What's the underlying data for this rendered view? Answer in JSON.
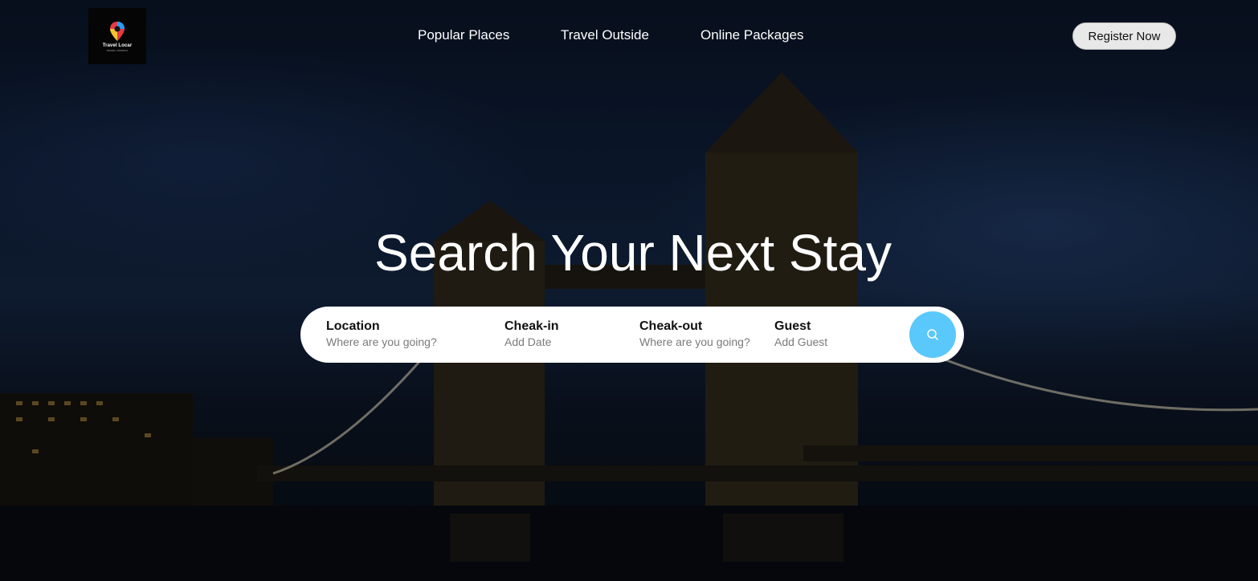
{
  "brand": {
    "logo_text": "Travel Locar",
    "logo_tagline": "TRAVEL COMPANY"
  },
  "nav": {
    "items": [
      "Popular Places",
      "Travel Outside",
      "Online Packages"
    ]
  },
  "header": {
    "register_label": "Register Now"
  },
  "hero": {
    "title": "Search Your Next Stay"
  },
  "search": {
    "fields": [
      {
        "label": "Location",
        "hint": "Where are you going?"
      },
      {
        "label": "Cheak-in",
        "hint": "Add Date"
      },
      {
        "label": "Cheak-out",
        "hint": "Where are you going?"
      },
      {
        "label": "Guest",
        "hint": "Add Guest"
      }
    ],
    "button_icon": "search-icon"
  },
  "colors": {
    "search_button": "#5ac8fa",
    "register_button": "#e8e8e8",
    "headline": "#ffffff"
  }
}
